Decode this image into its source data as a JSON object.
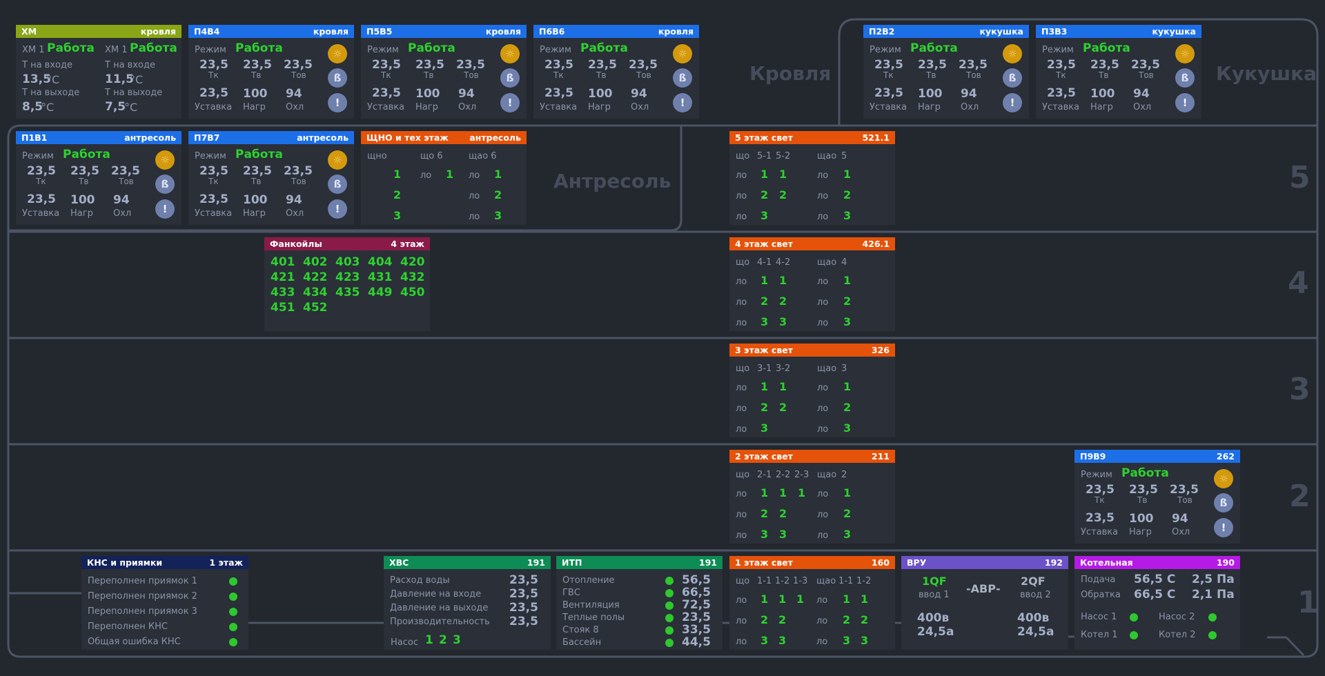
{
  "colors": {
    "bg": "#23272e",
    "panel": "#2a2f38",
    "line": "#4c5565",
    "xm": "#8aa617",
    "blue": "#1d6fe8",
    "orange": "#e5520a",
    "maroon": "#8a1a48",
    "navy": "#13235a",
    "green": "#0e8c55",
    "purple": "#6b52c8",
    "magenta": "#b51ae6",
    "ok": "#2fd12f",
    "value": "#a4afc7"
  },
  "zones": {
    "roof": "Кровля",
    "cuckoo": "Кукушка",
    "mezzanine": "Антресоль",
    "f5": "5",
    "f4": "4",
    "f3": "3",
    "f2": "2",
    "f1": "1"
  },
  "units": {
    "mode": "Режим",
    "mode_val": "Работа",
    "tk": "Тк",
    "tv": "Тв",
    "tov": "Тов",
    "setpoint": "Уставка",
    "heat": "Нагр",
    "cool": "Охл",
    "val": "23,5",
    "h": "100",
    "c": "94"
  },
  "icons": {
    "sun": "sun-icon",
    "fan": "fan-icon",
    "alarm": "alarm-icon"
  },
  "xm": {
    "title": "ХМ",
    "loc": "кровля",
    "units": [
      {
        "name": "ХМ 1",
        "state": "Работа",
        "t_in_label": "Т на входе",
        "t_in": "13,5",
        "t_out_label": "Т на выходе",
        "t_out": "8,5",
        "unit": "°C"
      },
      {
        "name": "ХМ 1",
        "state": "Работа",
        "t_in_label": "Т на входе",
        "t_in": "11,5",
        "t_out_label": "Т на выходе",
        "t_out": "7,5",
        "unit": "°C"
      }
    ]
  },
  "vents": [
    {
      "title": "П4В4",
      "loc": "кровля"
    },
    {
      "title": "П5В5",
      "loc": "кровля"
    },
    {
      "title": "П6В6",
      "loc": "кровля"
    },
    {
      "title": "П2В2",
      "loc": "кукушка"
    },
    {
      "title": "П3В3",
      "loc": "кукушка"
    },
    {
      "title": "П1В1",
      "loc": "антресоль"
    },
    {
      "title": "П7В7",
      "loc": "антресоль"
    },
    {
      "title": "П9В9",
      "loc": "262"
    }
  ],
  "shno": {
    "title": "ЩНО и тех этаж",
    "loc": "антресоль",
    "c1": "щно",
    "c2": "що 6",
    "c3": "щао 6",
    "lo": "ло",
    "v1": [
      "1",
      "2",
      "3"
    ],
    "v2": "1",
    "v3": [
      "1",
      "2",
      "3"
    ]
  },
  "fancoils": {
    "title": "Фанкойлы",
    "loc": "4 этаж",
    "items": [
      "401",
      "402",
      "403",
      "404",
      "420",
      "421",
      "422",
      "423",
      "431",
      "432",
      "433",
      "434",
      "435",
      "449",
      "450",
      "451",
      "452"
    ]
  },
  "light": [
    {
      "title": "5 этаж свет",
      "num": "521.1",
      "h1": "що",
      "cols": [
        "5-1",
        "5-2"
      ],
      "h2": "щао",
      "col2": "5",
      "rows": [
        [
          "1",
          "1"
        ],
        [
          "2",
          "2"
        ],
        [
          "3",
          ""
        ]
      ],
      "rows2": [
        "1",
        "2",
        "3"
      ]
    },
    {
      "title": "4 этаж свет",
      "num": "426.1",
      "h1": "що",
      "cols": [
        "4-1",
        "4-2"
      ],
      "h2": "щао",
      "col2": "4",
      "rows": [
        [
          "1",
          "1"
        ],
        [
          "2",
          "2"
        ],
        [
          "3",
          "3"
        ]
      ],
      "rows2": [
        "1",
        "2",
        "3"
      ]
    },
    {
      "title": "3 этаж свет",
      "num": "326",
      "h1": "що",
      "cols": [
        "3-1",
        "3-2"
      ],
      "h2": "щао",
      "col2": "3",
      "rows": [
        [
          "1",
          "1"
        ],
        [
          "2",
          "2"
        ],
        [
          "3",
          ""
        ]
      ],
      "rows2": [
        "1",
        "2",
        "3"
      ]
    },
    {
      "title": "2 этаж свет",
      "num": "211",
      "h1": "що",
      "cols": [
        "2-1",
        "2-2",
        "2-3"
      ],
      "h2": "щао",
      "col2": "2",
      "rows": [
        [
          "1",
          "1",
          "1"
        ],
        [
          "2",
          "2",
          ""
        ],
        [
          "3",
          "3",
          ""
        ]
      ],
      "rows2": [
        "1",
        "2",
        "3"
      ]
    }
  ],
  "light1": {
    "title": "1 этаж свет",
    "num": "160",
    "h1": "що",
    "cols": [
      "1-1",
      "1-2",
      "1-3"
    ],
    "h2": "щао",
    "cols2": [
      "1-1",
      "1-2"
    ],
    "rows": [
      [
        "1",
        "1",
        "1"
      ],
      [
        "2",
        "2",
        ""
      ],
      [
        "3",
        "3",
        ""
      ]
    ],
    "rows2": [
      [
        "1",
        "1"
      ],
      [
        "2",
        "2"
      ],
      [
        "3",
        "3"
      ]
    ]
  },
  "kns": {
    "title": "КНС и приямки",
    "loc": "1 этаж",
    "items": [
      "Переполнен приямок 1",
      "Переполнен приямок 2",
      "Переполнен приямок 3",
      "Переполнен КНС",
      "Общая ошибка КНС"
    ]
  },
  "hvs": {
    "title": "ХВС",
    "num": "191",
    "rows": [
      {
        "label": "Расход воды",
        "value": "23,5"
      },
      {
        "label": "Давление на входе",
        "value": "23,5"
      },
      {
        "label": "Давление на выходе",
        "value": "23,5"
      },
      {
        "label": "Производительность",
        "value": "23,5"
      }
    ],
    "pump_label": "Насос",
    "pumps": [
      "1",
      "2",
      "3"
    ]
  },
  "itp": {
    "title": "ИТП",
    "num": "191",
    "rows": [
      {
        "label": "Отопление",
        "value": "56,5"
      },
      {
        "label": "ГВС",
        "value": "66,5"
      },
      {
        "label": "Вентиляция",
        "value": "72,5"
      },
      {
        "label": "Теплые полы",
        "value": "23,5"
      },
      {
        "label": "Стояк 8",
        "value": "33,5"
      },
      {
        "label": "Бассейн",
        "value": "44,5"
      }
    ]
  },
  "vru": {
    "title": "ВРУ",
    "num": "192",
    "qf1": "1QF",
    "in1": "ввод 1",
    "avr": "-АВР-",
    "qf2": "2QF",
    "in2": "ввод 2",
    "v1": "400в",
    "a1": "24,5а",
    "v2": "400в",
    "a2": "24,5а"
  },
  "boiler": {
    "title": "Котельная",
    "num": "190",
    "supply_label": "Подача",
    "supply_t": "56,5 С",
    "supply_p": "2,5 Па",
    "return_label": "Обратка",
    "return_t": "66,5 С",
    "return_p": "2,1 Па",
    "pump1": "Насос 1",
    "pump2": "Насос 2",
    "boiler1": "Котел 1",
    "boiler2": "Котел 2"
  }
}
